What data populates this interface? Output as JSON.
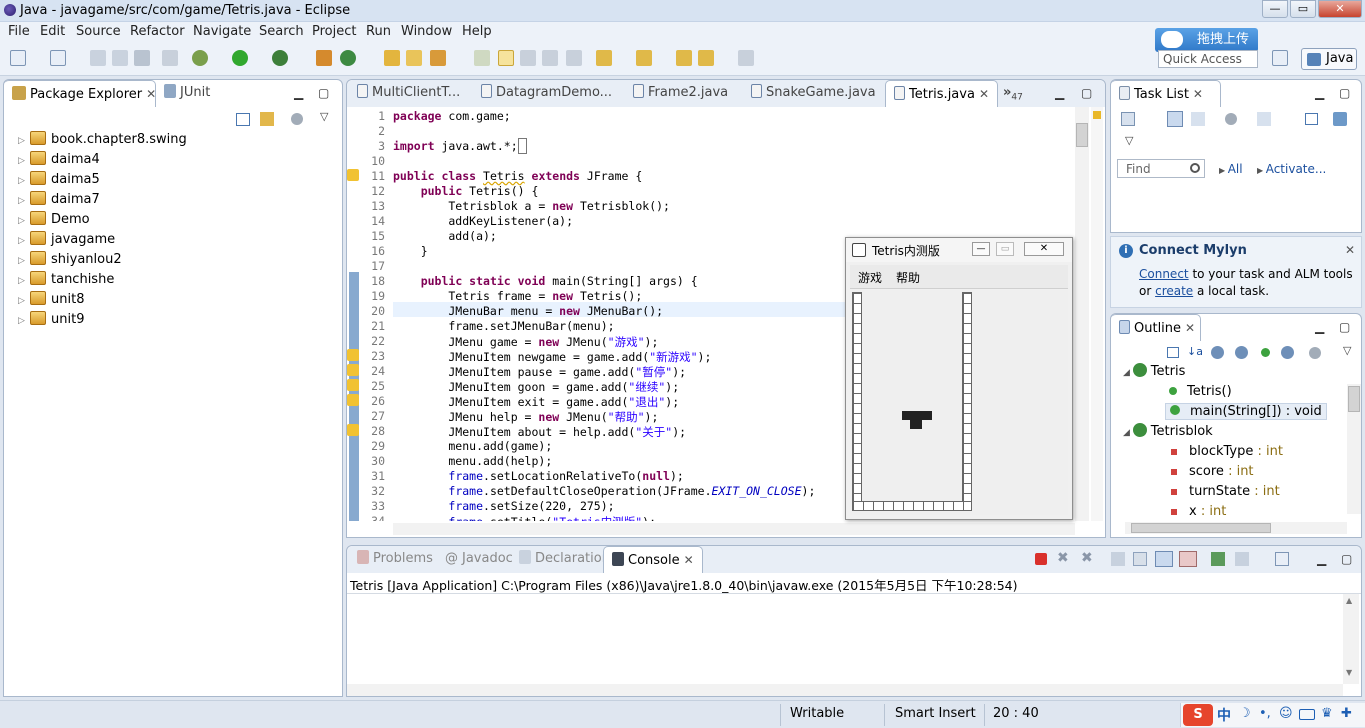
{
  "window": {
    "title": "Java - javagame/src/com/game/Tetris.java - Eclipse"
  },
  "menu": [
    "File",
    "Edit",
    "Source",
    "Refactor",
    "Navigate",
    "Search",
    "Project",
    "Run",
    "Window",
    "Help"
  ],
  "upload_badge": "拖拽上传",
  "quick_access": "Quick Access",
  "perspective": "Java",
  "left_panel": {
    "tabs": [
      "Package Explorer",
      "JUnit"
    ],
    "projects": [
      "book.chapter8.swing",
      "daima4",
      "daima5",
      "daima7",
      "Demo",
      "javagame",
      "shiyanlou2",
      "tanchishe",
      "unit8",
      "unit9"
    ]
  },
  "editor": {
    "tabs": [
      "MultiClientT...",
      "DatagramDemo...",
      "Frame2.java",
      "SnakeGame.java",
      "Tetris.java"
    ],
    "overflow": "47",
    "line_numbers": [
      "1",
      "2",
      "3",
      "10",
      "11",
      "12",
      "13",
      "14",
      "15",
      "16",
      "17",
      "18",
      "19",
      "20",
      "21",
      "22",
      "23",
      "24",
      "25",
      "26",
      "27",
      "28",
      "29",
      "30",
      "31",
      "32",
      "33",
      "34"
    ]
  },
  "tetris_window": {
    "title": "Tetris内测版",
    "menu": [
      "游戏",
      "帮助"
    ]
  },
  "task_list": {
    "tab": "Task List",
    "find_placeholder": "Find",
    "all": "All",
    "activate": "Activate..."
  },
  "mylyn": {
    "title": "Connect Mylyn",
    "link1": "Connect",
    "text1": " to your task and ALM tools",
    "text2": "or ",
    "link2": "create",
    "text3": " a local task."
  },
  "outline": {
    "tab": "Outline",
    "items": [
      {
        "name": "Tetris",
        "type": ""
      },
      {
        "name": "Tetris()",
        "type": ""
      },
      {
        "name": "main(String[])",
        "type": " : void"
      },
      {
        "name": "Tetrisblok",
        "type": ""
      },
      {
        "name": "blockType",
        "type": " : int"
      },
      {
        "name": "score",
        "type": " : int"
      },
      {
        "name": "turnState",
        "type": " : int"
      },
      {
        "name": "x",
        "type": " : int"
      }
    ]
  },
  "bottom": {
    "tabs": [
      "Problems",
      "Javadoc",
      "Declaration",
      "Console"
    ],
    "console_header": "Tetris [Java Application] C:\\Program Files (x86)\\Java\\jre1.8.0_40\\bin\\javaw.exe (2015年5月5日 下午10:28:54)"
  },
  "status": {
    "writable": "Writable",
    "insert": "Smart Insert",
    "position": "20 : 40"
  },
  "tray": {
    "ime": "中"
  }
}
